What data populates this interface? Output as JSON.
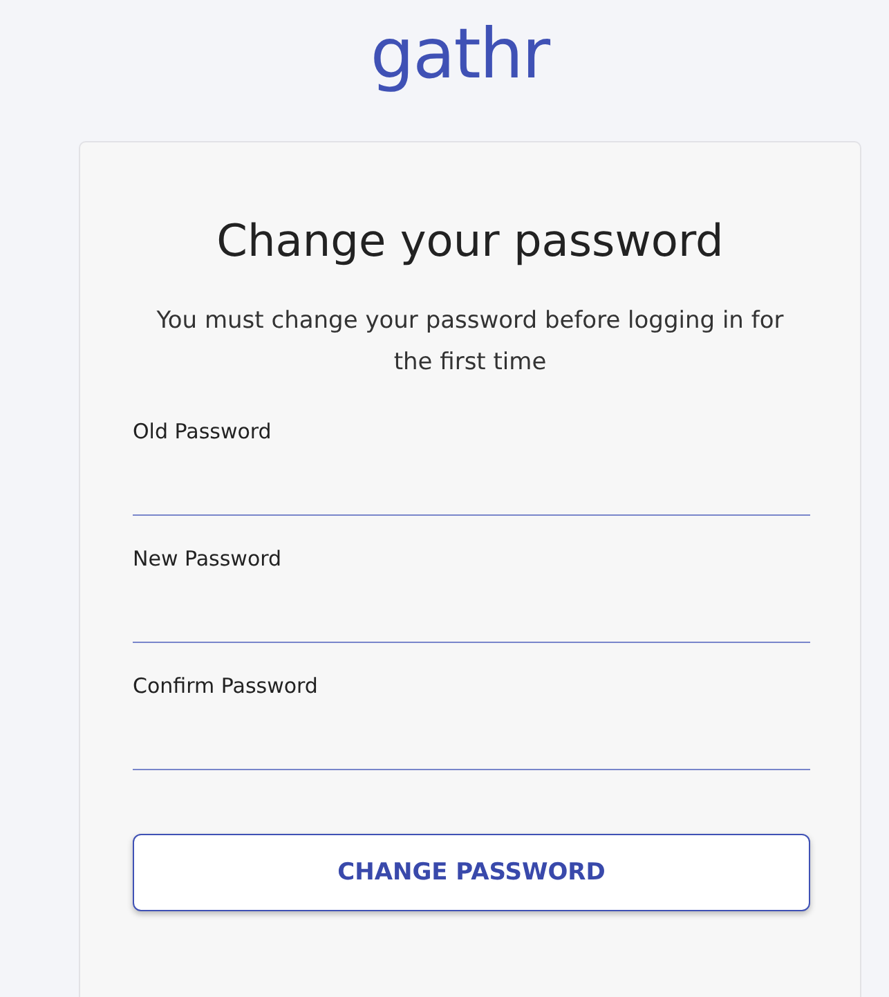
{
  "logo": "gathr",
  "card": {
    "title": "Change your password",
    "subtitle": "You must change your password before logging in for the first time",
    "fields": [
      {
        "label": "Old Password"
      },
      {
        "label": "New Password"
      },
      {
        "label": "Confirm Password"
      }
    ],
    "button": "CHANGE PASSWORD"
  }
}
